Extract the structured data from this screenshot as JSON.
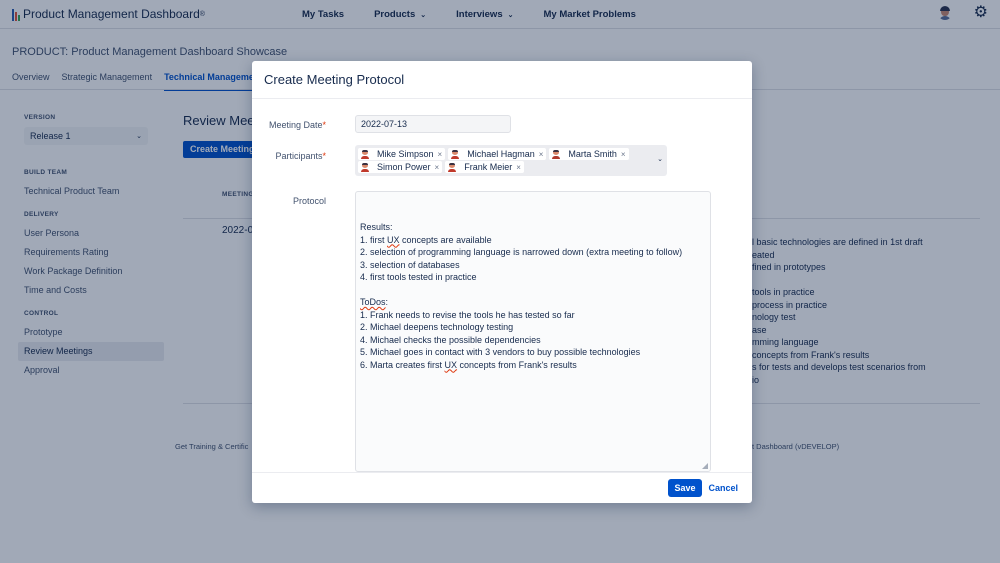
{
  "app": {
    "logo_text": "Product Management Dashboard",
    "logo_mark": "®",
    "nav": [
      {
        "label": "My Tasks",
        "has_dropdown": false
      },
      {
        "label": "Products",
        "has_dropdown": true
      },
      {
        "label": "Interviews",
        "has_dropdown": true
      },
      {
        "label": "My Market Problems",
        "has_dropdown": false
      }
    ],
    "icons": {
      "avatar": "user-avatar-icon",
      "settings": "gear-icon",
      "chevron": "⌄"
    }
  },
  "product": {
    "title": "PRODUCT: Product Management Dashboard Showcase",
    "tabs": [
      {
        "label": "Overview",
        "active": false
      },
      {
        "label": "Strategic Management",
        "active": false
      },
      {
        "label": "Technical Management",
        "active": true
      }
    ]
  },
  "sidebar": {
    "version_heading": "VERSION",
    "version_value": "Release 1",
    "build_team_heading": "BUILD TEAM",
    "build_team_items": [
      "Technical Product Team"
    ],
    "delivery_heading": "DELIVERY",
    "delivery_items": [
      "User Persona",
      "Requirements Rating",
      "Work Package Definition",
      "Time and Costs"
    ],
    "control_heading": "CONTROL",
    "control_items": [
      "Prototype",
      "Review Meetings",
      "Approval"
    ],
    "active_item": "Review Meetings"
  },
  "main": {
    "title": "Review Meetings",
    "create_button": "Create Meeting",
    "column_header": "MEETING",
    "row_date": "2022-0",
    "partial_lines": [
      "l basic technologies are defined in 1st draft",
      "eated",
      "fined in prototypes",
      "",
      "tools in practice",
      "process in practice",
      "nology test",
      "ase",
      "mming language",
      "concepts from Frank's results",
      "s for tests and develops test scenarios from",
      "io"
    ],
    "footer_left": "Get Training & Certific",
    "footer_right": "t Dashboard (vDEVELOP)"
  },
  "modal": {
    "title": "Create Meeting Protocol",
    "meeting_date_label": "Meeting Date",
    "meeting_date_value": "2022-07-13",
    "participants_label": "Participants",
    "required_mark": "*",
    "participants": [
      "Mike Simpson",
      "Michael Hagman",
      "Marta Smith",
      "Simon Power",
      "Frank Meier"
    ],
    "remove_glyph": "×",
    "protocol_label": "Protocol",
    "protocol_lines": [
      "Results:",
      "1. first UX concepts are available",
      "2. selection of programming language is narrowed down (extra meeting to follow)",
      "3. selection of databases",
      "4. first tools tested in practice",
      "",
      "ToDos:",
      "1. Frank needs to revise the tools he has tested so far",
      "2. Michael deepens technology testing",
      "4. Michael checks the possible dependencies",
      "5. Michael goes in contact with 3 vendors to buy possible technologies",
      "6. Marta creates first UX concepts from Frank's results"
    ],
    "save_label": "Save",
    "cancel_label": "Cancel"
  },
  "colors": {
    "primary": "#0052cc",
    "text": "#172b4d",
    "subtle_text": "#42526e",
    "required": "#de350b",
    "overlay": "rgba(9,30,66,0.38)"
  }
}
